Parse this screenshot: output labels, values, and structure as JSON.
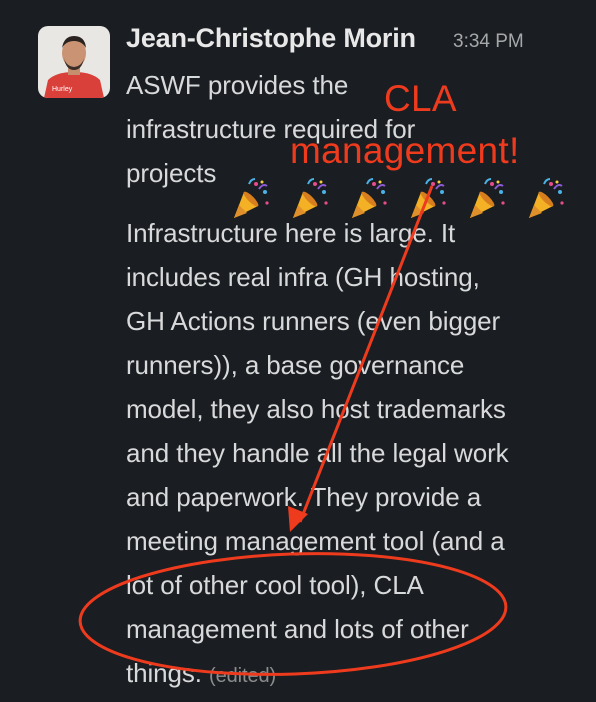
{
  "message": {
    "sender": "Jean-Christophe Morin",
    "time": "3:34 PM",
    "avatar_shirt_text": "Hurley",
    "paragraph1": [
      "ASWF provides the",
      "infrastructure required for",
      "projects"
    ],
    "emoji": "party-popper-icon",
    "emoji_count": 6,
    "paragraph2": [
      "Infrastructure here is large. It",
      "includes real infra (GH hosting,",
      "GH Actions runners (even bigger",
      "runners)), a base governance",
      "model, they also host trademarks",
      "and they handle all the legal work",
      "and paperwork. They provide a",
      "meeting management tool (and a",
      "lot of other cool tool), CLA",
      "management and lots of other",
      "things."
    ],
    "edited_label": "(edited)"
  },
  "annotation": {
    "text_line1": "CLA",
    "text_line2": "management!",
    "color": "#ee3b1e"
  },
  "colors": {
    "background": "#1a1d21",
    "text": "#d8d9da",
    "sender": "#e8e8e8",
    "timestamp": "#a6a7a9"
  }
}
